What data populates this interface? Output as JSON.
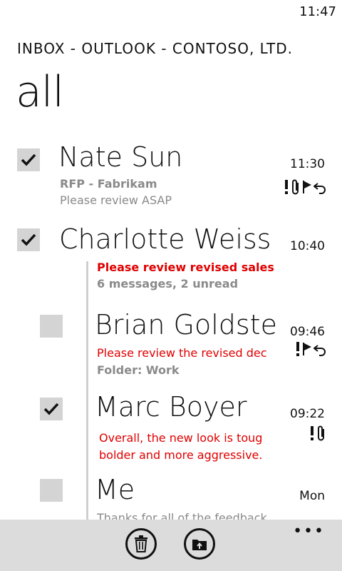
{
  "status": {
    "time": "11:47"
  },
  "header": {
    "app_title": "INBOX - OUTLOOK - CONTOSO, LTD.",
    "pivot": "all"
  },
  "messages": [
    {
      "sender": "Nate Sun",
      "time": "11:30",
      "line1": "RFP - Fabrikam",
      "line2": "Please review ASAP",
      "checked": true,
      "icons": [
        "high-importance-icon",
        "attachment-icon",
        "flag-icon",
        "reply-icon"
      ]
    },
    {
      "sender": "Charlotte Weiss",
      "time": "10:40",
      "line1": "Please review revised sales c",
      "line2": "6 messages, 2 unread",
      "checked": true,
      "icons": []
    },
    {
      "sender": "Brian Goldstein",
      "time": "09:46",
      "line1": "Please review the revised dec",
      "line2": "Folder: Work",
      "checked": false,
      "icons": [
        "high-importance-icon",
        "flag-icon",
        "reply-icon"
      ]
    },
    {
      "sender": "Marc Boyer",
      "time": "09:22",
      "line1": "Overall, the new look is toug",
      "line2": "bolder and more aggressive.",
      "checked": true,
      "icons": [
        "high-importance-icon",
        "attachment-icon"
      ]
    },
    {
      "sender": "Me",
      "time": "Mon",
      "line1": "Thanks for all of the feedback",
      "line2": "",
      "checked": false,
      "icons": []
    }
  ],
  "appbar": {
    "buttons": [
      "delete-icon",
      "move-to-folder-icon"
    ],
    "more": "•••"
  },
  "colors": {
    "accent": "#e00000",
    "checkbox": "#d4d4d4",
    "appbar": "#dcdcdc",
    "thread_line": "#cfcfcf"
  }
}
